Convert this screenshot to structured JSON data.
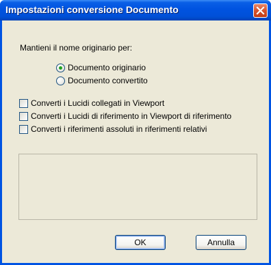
{
  "window": {
    "title": "Impostazioni conversione Documento"
  },
  "dialog": {
    "keep_name_label": "Mantieni il nome originario per:",
    "radio_options": [
      {
        "label": "Documento originario",
        "selected": true
      },
      {
        "label": "Documento convertito",
        "selected": false
      }
    ],
    "checkboxes": [
      {
        "label": "Converti i Lucidi collegati in Viewport",
        "checked": false
      },
      {
        "label": "Converti i Lucidi di riferimento in Viewport di riferimento",
        "checked": false
      },
      {
        "label": "Converti i riferimenti assoluti in riferimenti relativi",
        "checked": false
      }
    ]
  },
  "buttons": {
    "ok_label": "OK",
    "cancel_label": "Annulla"
  },
  "colors": {
    "titlebar": "#0054e3",
    "dialog_bg": "#ece9d8",
    "close_button": "#d6522c",
    "radio_selected": "#21a121"
  }
}
